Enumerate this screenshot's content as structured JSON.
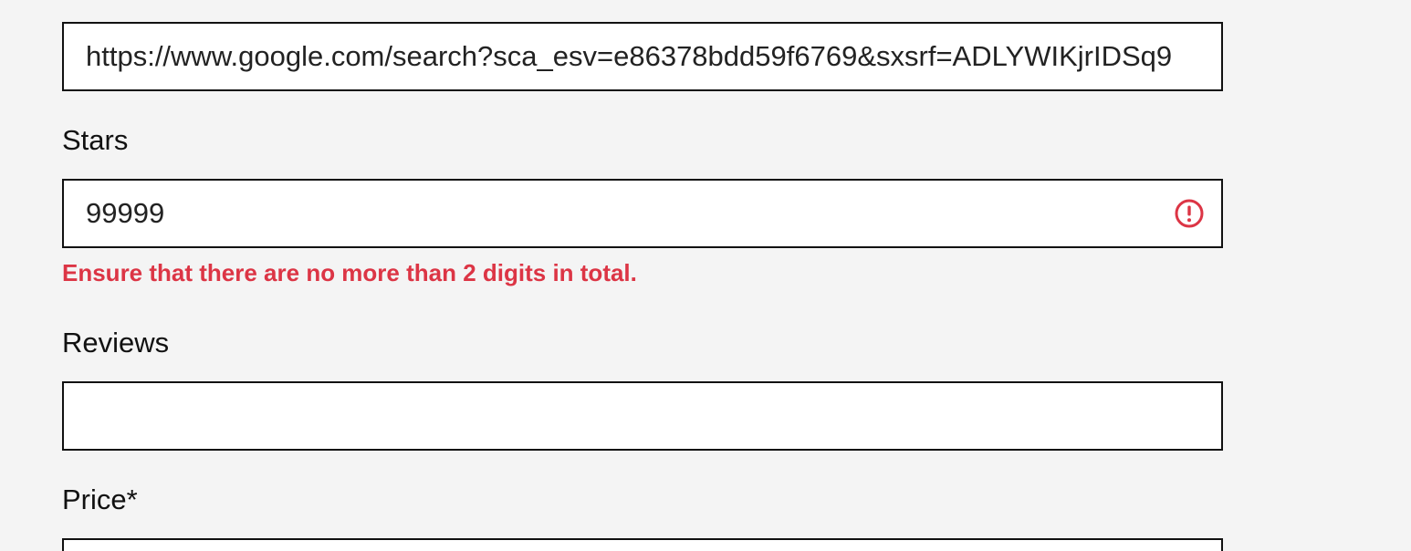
{
  "form": {
    "url_field": {
      "value": "https://www.google.com/search?sca_esv=e86378bdd59f6769&sxsrf=ADLYWIKjrIDSq9"
    },
    "stars": {
      "label": "Stars",
      "value": "99999",
      "error": "Ensure that there are no more than 2 digits in total.",
      "error_icon": "exclamation-circle-icon"
    },
    "reviews": {
      "label": "Reviews",
      "value": ""
    },
    "price": {
      "label": "Price*",
      "value": ""
    }
  },
  "colors": {
    "background": "#f4f4f4",
    "input_background": "#ffffff",
    "border": "#111111",
    "error": "#dc3545"
  }
}
